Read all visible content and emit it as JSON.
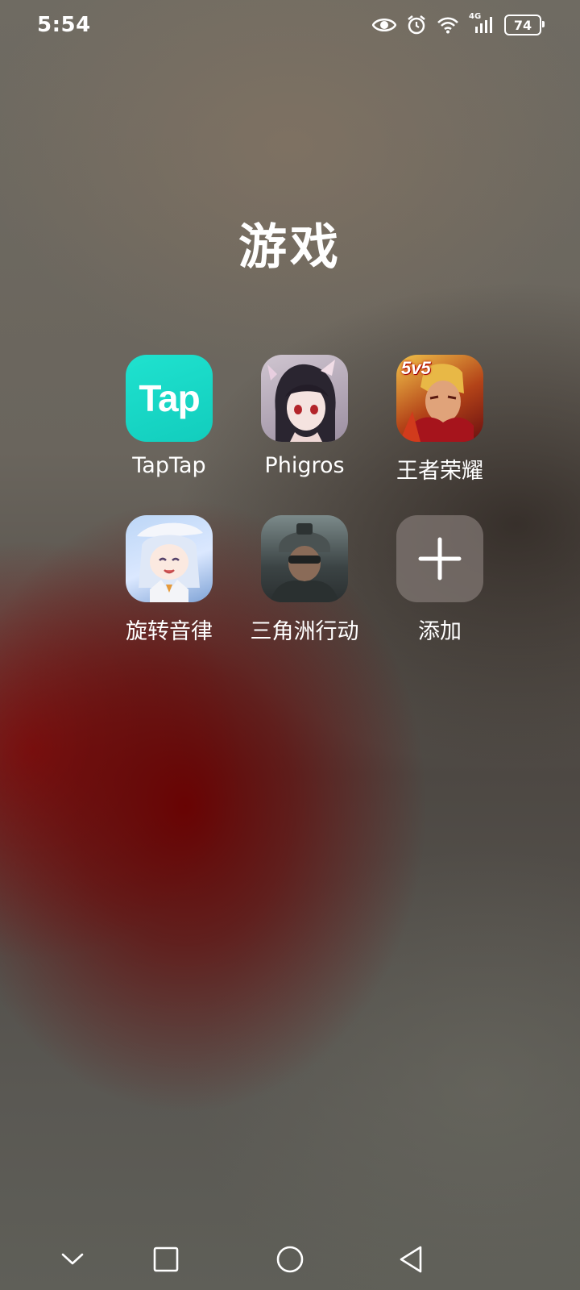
{
  "status_bar": {
    "time": "5:54",
    "battery": "74",
    "network_label": "4G",
    "icons": [
      "eye-icon",
      "alarm-icon",
      "wifi-icon",
      "signal-icon",
      "battery-icon"
    ]
  },
  "folder": {
    "title": "游戏",
    "apps": [
      {
        "label": "TapTap",
        "icon_text": "Tap",
        "icon": "taptap-icon"
      },
      {
        "label": "Phigros",
        "icon": "phigros-icon"
      },
      {
        "label": "王者荣耀",
        "icon_text": "5v5",
        "icon": "honor-of-kings-icon"
      },
      {
        "label": "旋转音律",
        "icon": "rotaeno-icon"
      },
      {
        "label": "三角洲行动",
        "icon": "delta-force-icon"
      },
      {
        "label": "添加",
        "icon": "plus-icon"
      }
    ]
  },
  "nav_bar": {
    "buttons": [
      "chevron-down-icon",
      "recents-square-icon",
      "home-circle-icon",
      "back-triangle-icon"
    ]
  },
  "colors": {
    "taptap": "#18d7c5",
    "wallpaper_red": "#690000",
    "text": "#ffffff"
  }
}
